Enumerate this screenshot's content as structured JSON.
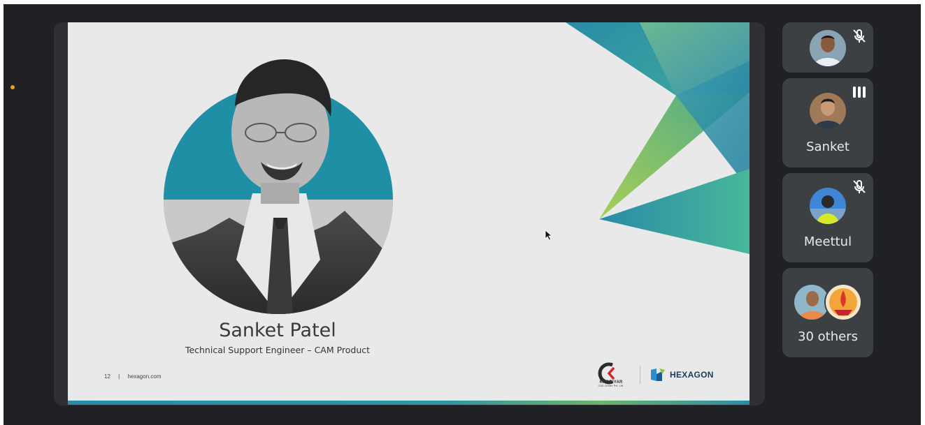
{
  "slide": {
    "speaker_name": "Sanket Patel",
    "speaker_title": "Technical Support Engineer – CAM Product",
    "page_number": "12",
    "separator": "|",
    "website": "hexagon.com",
    "partner_logo_text": "KHODIYAR",
    "partner_logo_subtext": "CAD Center Pvt. Ltd.",
    "brand_logo_text": "HEXAGON"
  },
  "participants": [
    {
      "name": "",
      "mic": "muted",
      "avatar": "person-photo"
    },
    {
      "name": "Sanket",
      "mic": "speaking",
      "avatar": "person-photo"
    },
    {
      "name": "Meettul",
      "mic": "muted",
      "avatar": "person-photo"
    },
    {
      "name": "30 others",
      "mic": "",
      "avatar": "avatar-stack"
    }
  ],
  "colors": {
    "background": "#202124",
    "tile": "#3c4043",
    "accent_teal": "#2596a6",
    "accent_green": "#7cbb5f",
    "presenter_dot": "#e8a317"
  }
}
